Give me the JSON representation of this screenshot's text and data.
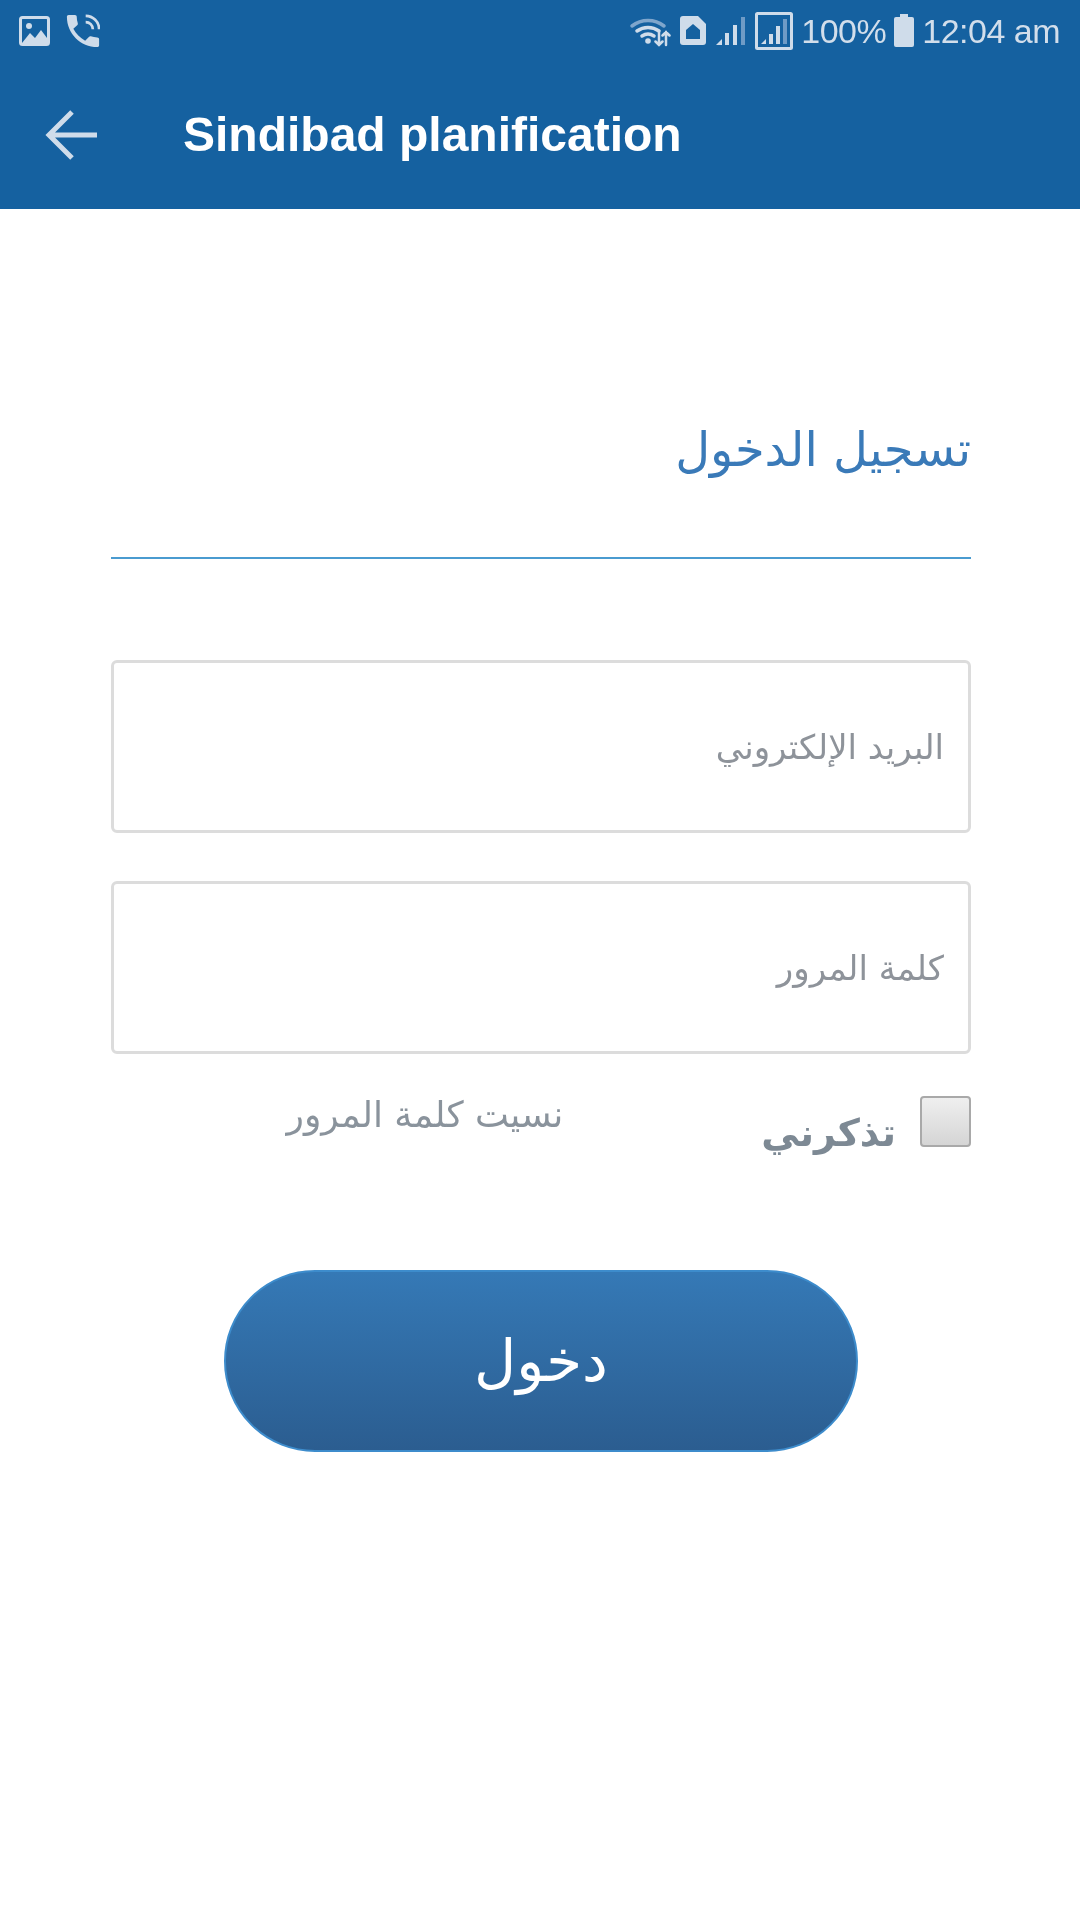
{
  "status_bar": {
    "battery": "100%",
    "time": "12:04 am"
  },
  "app_bar": {
    "title": "Sindibad planification"
  },
  "login": {
    "heading": "تسجيل الدخول",
    "fields": [
      {
        "placeholder": "البريد الإلكتروني"
      },
      {
        "placeholder": "كلمة المرور"
      }
    ],
    "remember_me": {
      "label": "تذكرني",
      "checked": false
    },
    "forgot_password": "نسيت كلمة المرور",
    "submit": "دخول"
  }
}
